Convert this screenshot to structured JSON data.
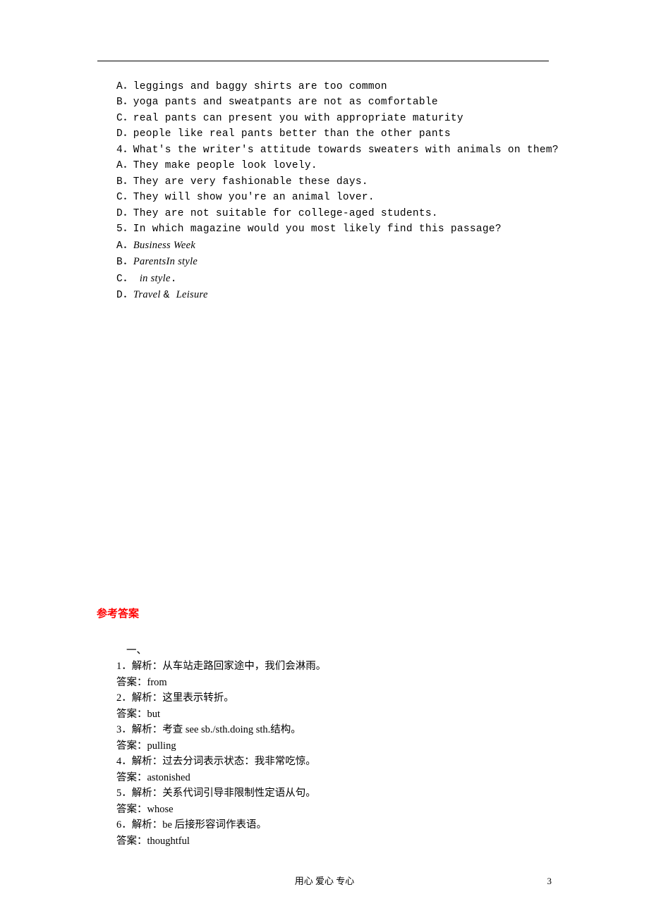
{
  "questions": {
    "q3_options": {
      "A": "A．leggings and baggy shirts are too common",
      "B": "B．yoga pants and sweatpants are not as comfortable",
      "C": "C．real pants can present you with appropriate maturity",
      "D": "D．people like real pants better than the other pants"
    },
    "q4": {
      "stem": "4．What's the writer's attitude towards sweaters with animals on them?",
      "A": "A．They make people look lovely.",
      "B": "B．They are very fashionable these days.",
      "C": "C．They will show you're an animal lover.",
      "D": "D．They are not suitable for college-aged students."
    },
    "q5": {
      "stem": "5．In which magazine would you most likely find this passage?",
      "A_pre": "A．",
      "A_ital": "Business Week",
      "B_pre": "B．",
      "B_ital": "ParentsIn style",
      "C_pre": "C． ",
      "C_ital": "in style",
      "C_post": ".",
      "D_pre": "D．",
      "D_ital": "Travel ",
      "D_amp": "& ",
      "D_ital2": "Leisure"
    }
  },
  "answers_heading": "参考答案",
  "answers": {
    "section": "一、",
    "items": [
      {
        "exp": "1．解析：从车站走路回家途中，我们会淋雨。",
        "ans": "答案：from"
      },
      {
        "exp": "2．解析：这里表示转折。",
        "ans": "答案：but"
      },
      {
        "exp": "3．解析：考查 see sb./sth.doing sth.结构。",
        "ans": "答案：pulling"
      },
      {
        "exp": "4．解析：过去分词表示状态：我非常吃惊。",
        "ans": "答案：astonished"
      },
      {
        "exp": "5．解析：关系代词引导非限制性定语从句。",
        "ans": "答案：whose"
      },
      {
        "exp": "6．解析：be 后接形容词作表语。",
        "ans": "答案：thoughtful"
      }
    ]
  },
  "footer": "用心 爱心 专心",
  "page_number": "3"
}
